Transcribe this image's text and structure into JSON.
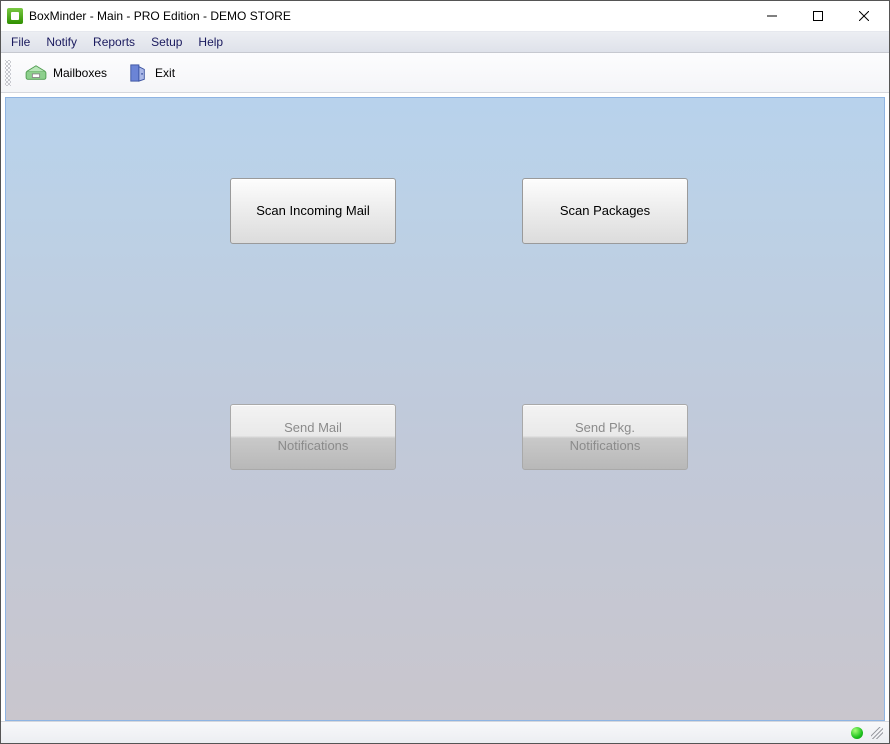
{
  "window": {
    "title": "BoxMinder - Main - PRO Edition - DEMO STORE"
  },
  "menu": {
    "file": "File",
    "notify": "Notify",
    "reports": "Reports",
    "setup": "Setup",
    "help": "Help"
  },
  "toolbar": {
    "mailboxes": "Mailboxes",
    "exit": "Exit"
  },
  "buttons": {
    "scan_mail": "Scan Incoming Mail",
    "scan_packages": "Scan Packages",
    "send_mail_line1": "Send Mail",
    "send_mail_line2": "Notifications",
    "send_pkg_line1": "Send Pkg.",
    "send_pkg_line2": "Notifications"
  },
  "status": {
    "connection": "online"
  }
}
